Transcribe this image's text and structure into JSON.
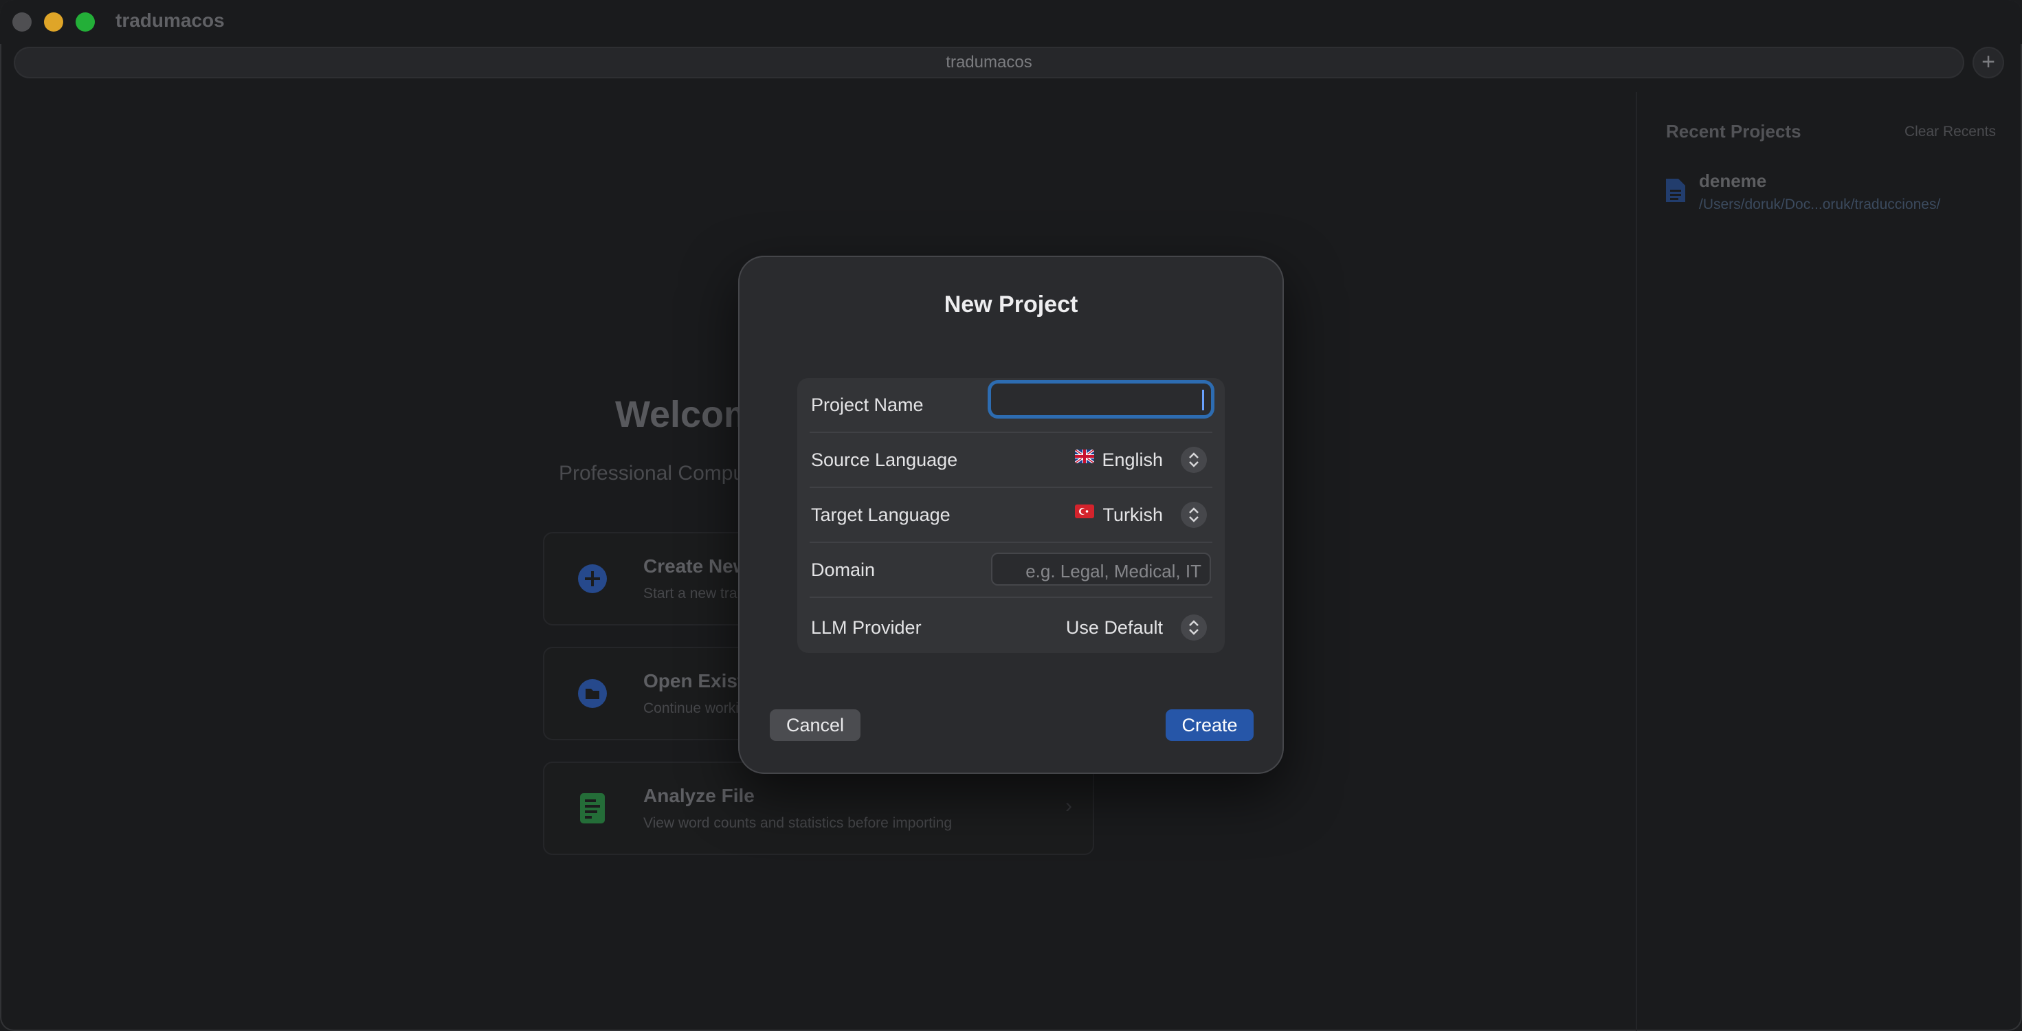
{
  "window": {
    "app_title": "tradumacos",
    "tab_title": "tradumacos",
    "add_tab_label": "+"
  },
  "sidebar": {
    "title": "Recent Projects",
    "clear_label": "Clear Recents",
    "items": [
      {
        "name": "deneme",
        "path": "/Users/doruk/Doc...oruk/traducciones/",
        "icon": "document-icon"
      }
    ]
  },
  "welcome": {
    "title": "Welcome to tradumacos",
    "subtitle": "Professional Computer-Assisted Translation",
    "cards": [
      {
        "title": "Create New Project",
        "desc": "Start a new translation project",
        "icon": "plus-circle-icon",
        "color": "#3262b3"
      },
      {
        "title": "Open Existing Project",
        "desc": "Continue working on a saved project",
        "icon": "folder-icon",
        "color": "#3262b3"
      },
      {
        "title": "Analyze File",
        "desc": "View word counts and statistics before importing",
        "icon": "document-chart-icon",
        "color": "#2f9a4e"
      }
    ]
  },
  "dialog": {
    "title": "New Project",
    "fields": {
      "project_name": {
        "label": "Project Name",
        "value": ""
      },
      "source_language": {
        "label": "Source Language",
        "value": "English",
        "flag": "gb-flag-icon"
      },
      "target_language": {
        "label": "Target Language",
        "value": "Turkish",
        "flag": "tr-flag-icon"
      },
      "domain": {
        "label": "Domain",
        "value": "",
        "placeholder": "e.g. Legal, Medical, IT"
      },
      "llm_provider": {
        "label": "LLM Provider",
        "value": "Use Default"
      }
    },
    "cancel_label": "Cancel",
    "create_label": "Create"
  },
  "colors": {
    "accent": "#2656a8",
    "focus_ring": "#2d6cb1",
    "traffic_min": "#febc2e",
    "traffic_max": "#28c840"
  }
}
